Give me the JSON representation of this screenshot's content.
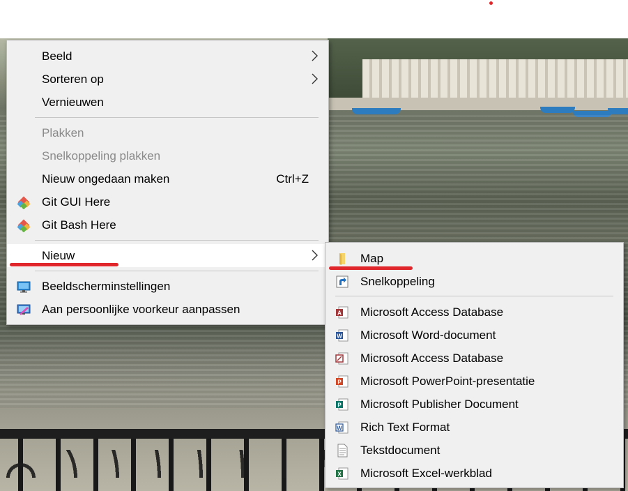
{
  "context_menu": {
    "items": [
      {
        "label": "Beeld",
        "submenu": true
      },
      {
        "label": "Sorteren op",
        "submenu": true
      },
      {
        "label": "Vernieuwen"
      },
      {
        "label": "Plakken",
        "disabled": true
      },
      {
        "label": "Snelkoppeling plakken",
        "disabled": true
      },
      {
        "label": "Nieuw ongedaan maken",
        "shortcut": "Ctrl+Z"
      },
      {
        "label": "Git GUI Here",
        "icon": "git-icon"
      },
      {
        "label": "Git Bash Here",
        "icon": "git-icon"
      },
      {
        "label": "Nieuw",
        "submenu": true,
        "highlighted": true
      },
      {
        "label": "Beeldscherminstellingen",
        "icon": "display-settings-icon"
      },
      {
        "label": "Aan persoonlijke voorkeur aanpassen",
        "icon": "personalize-icon"
      }
    ]
  },
  "new_submenu": {
    "items": [
      {
        "label": "Map",
        "icon": "folder-icon"
      },
      {
        "label": "Snelkoppeling",
        "icon": "shortcut-icon"
      },
      {
        "label": "Microsoft Access Database",
        "icon": "access-icon"
      },
      {
        "label": "Microsoft Word-document",
        "icon": "word-icon"
      },
      {
        "label": "Microsoft Access Database",
        "icon": "access-icon"
      },
      {
        "label": "Microsoft PowerPoint-presentatie",
        "icon": "powerpoint-icon"
      },
      {
        "label": "Microsoft Publisher Document",
        "icon": "publisher-icon"
      },
      {
        "label": "Rich Text Format",
        "icon": "rtf-icon"
      },
      {
        "label": "Tekstdocument",
        "icon": "text-document-icon"
      },
      {
        "label": "Microsoft Excel-werkblad",
        "icon": "excel-icon"
      }
    ]
  },
  "colors": {
    "menu_background": "#f0f0f0",
    "highlight": "#ffffff",
    "disabled_text": "#8a8a8a",
    "annotation_red": "#e0262b"
  }
}
